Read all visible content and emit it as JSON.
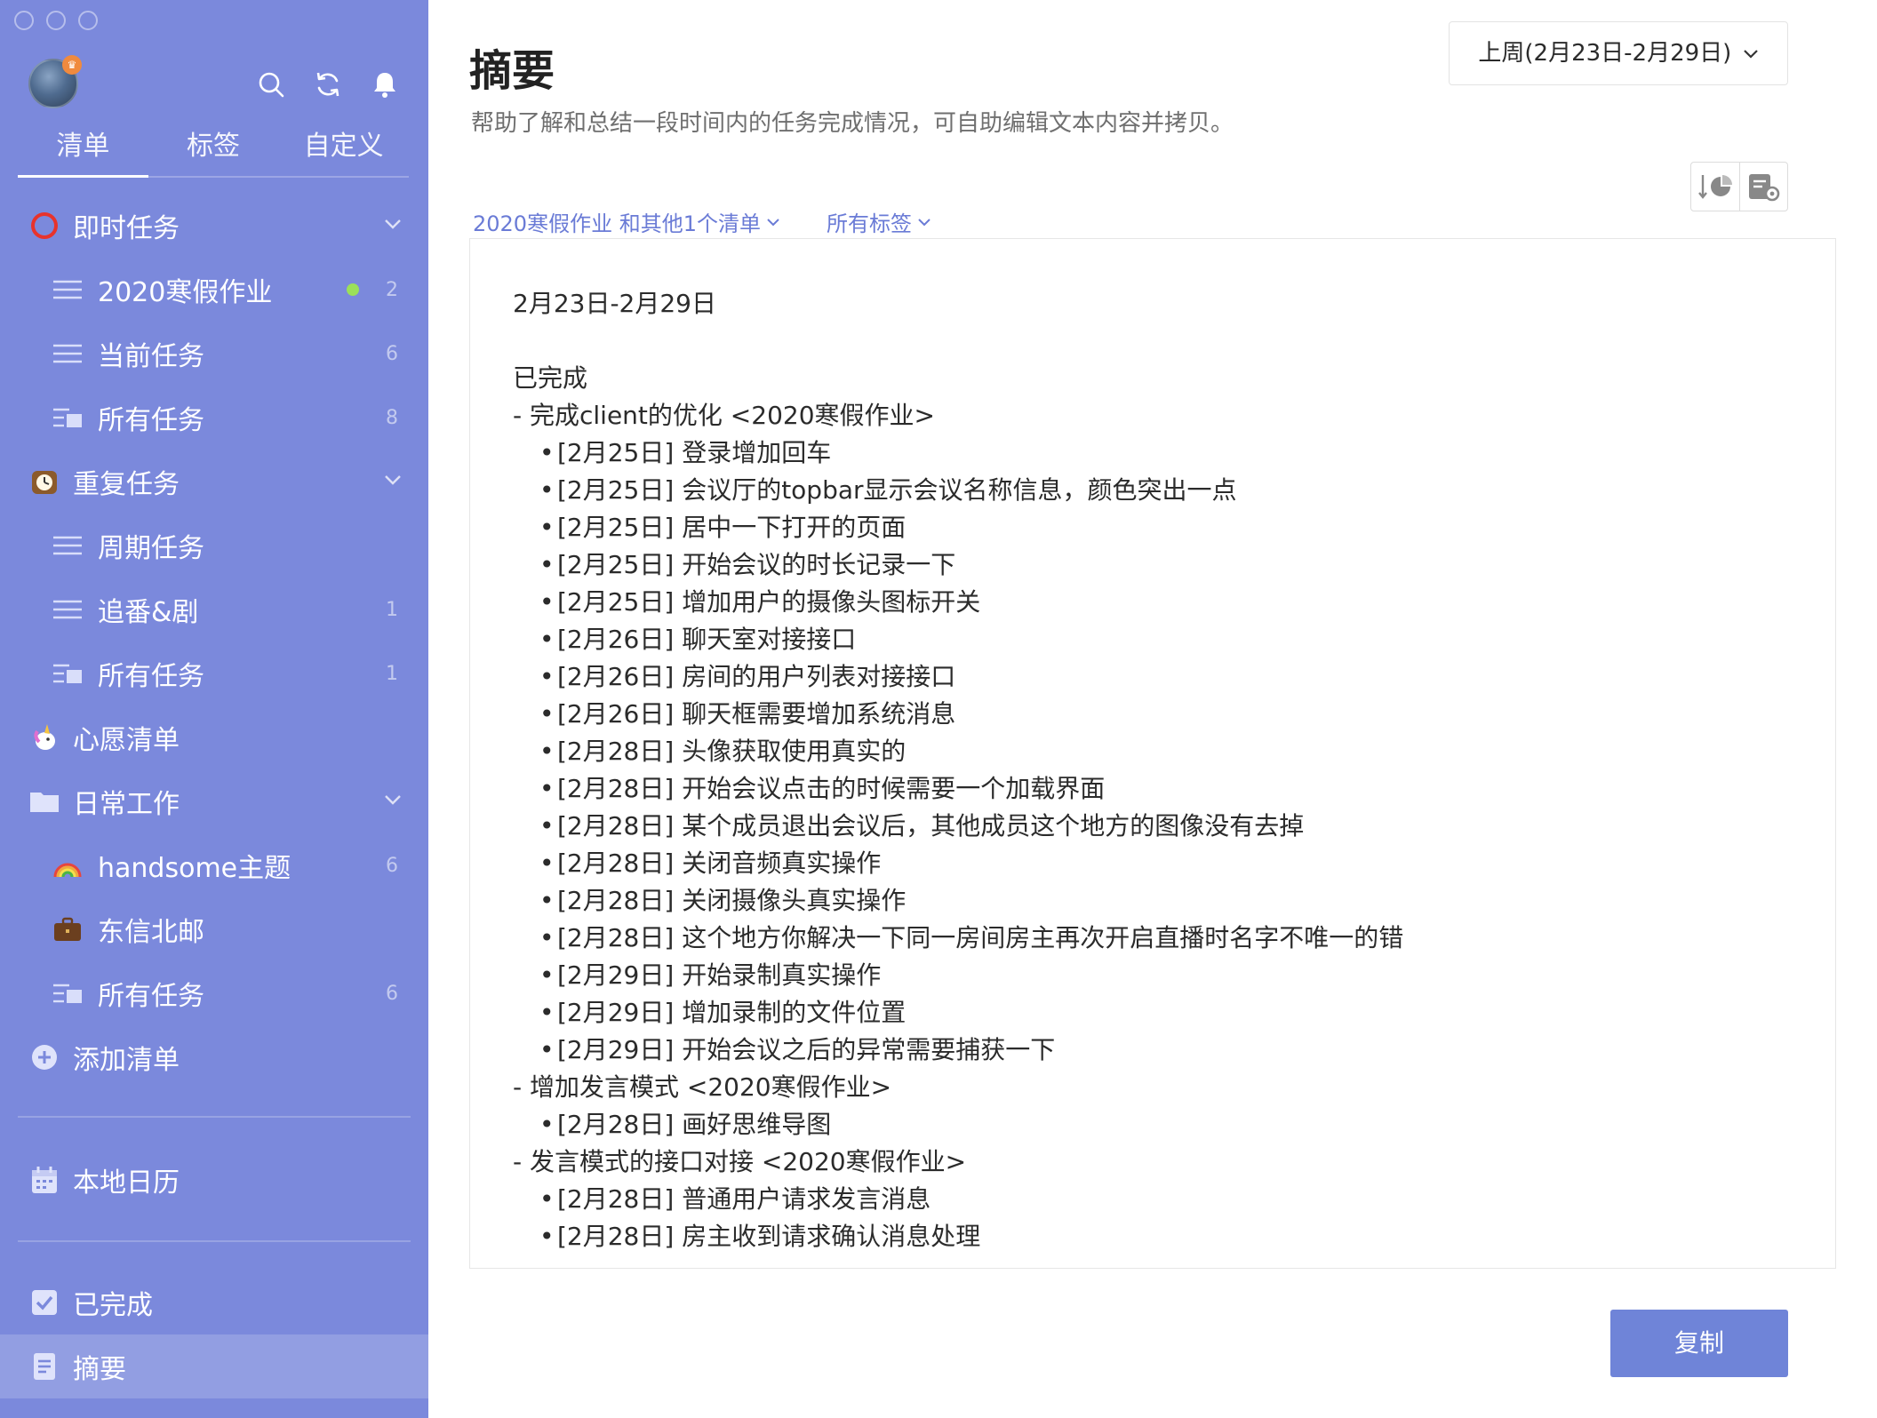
{
  "sidebar": {
    "tabs": [
      "清单",
      "标签",
      "自定义"
    ],
    "lists": {
      "instant": {
        "label": "即时任务",
        "icon": "red-ring-icon"
      },
      "homework": {
        "label": "2020寒假作业",
        "count": "2",
        "status_color": "#9be05a"
      },
      "current": {
        "label": "当前任务",
        "count": "6"
      },
      "all1": {
        "label": "所有任务",
        "count": "8"
      },
      "repeat": {
        "label": "重复任务",
        "icon": "clock-emoji-icon"
      },
      "periodic": {
        "label": "周期任务"
      },
      "anime": {
        "label": "追番&剧",
        "count": "1"
      },
      "all2": {
        "label": "所有任务",
        "count": "1"
      },
      "wish": {
        "label": "心愿清单",
        "icon": "unicorn-emoji-icon"
      },
      "daily": {
        "label": "日常工作",
        "icon": "folder-icon"
      },
      "handsome": {
        "label": "handsome主题",
        "count": "6",
        "icon": "rainbow-emoji-icon"
      },
      "dongxin": {
        "label": "东信北邮",
        "icon": "briefcase-emoji-icon"
      },
      "all3": {
        "label": "所有任务",
        "count": "6"
      },
      "add": {
        "label": "添加清单"
      }
    },
    "calendar": {
      "label": "本地日历"
    },
    "completed": {
      "label": "已完成"
    },
    "summary": {
      "label": "摘要"
    }
  },
  "main": {
    "title": "摘要",
    "subtitle": "帮助了解和总结一段时间内的任务完成情况，可自助编辑文本内容并拷贝。",
    "range": "上周(2月23日-2月29日)",
    "filter_lists": "2020寒假作业 和其他1个清单",
    "filter_tags": "所有标签",
    "copy_label": "复制",
    "summary": {
      "heading": "2月23日-2月29日",
      "section": "已完成",
      "groups": [
        {
          "title": "- 完成client的优化 <2020寒假作业>",
          "items": [
            "[2月25日] 登录增加回车",
            "[2月25日] 会议厅的topbar显示会议名称信息，颜色突出一点",
            "[2月25日] 居中一下打开的页面",
            "[2月25日] 开始会议的时长记录一下",
            "[2月25日] 增加用户的摄像头图标开关",
            "[2月26日] 聊天室对接接口",
            "[2月26日] 房间的用户列表对接接口",
            "[2月26日] 聊天框需要增加系统消息",
            "[2月28日] 头像获取使用真实的",
            "[2月28日] 开始会议点击的时候需要一个加载界面",
            "[2月28日] 某个成员退出会议后，其他成员这个地方的图像没有去掉",
            "[2月28日] 关闭音频真实操作",
            "[2月28日] 关闭摄像头真实操作",
            "[2月28日] 这个地方你解决一下同一房间房主再次开启直播时名字不唯一的错",
            "[2月29日] 开始录制真实操作",
            "[2月29日] 增加录制的文件位置",
            "[2月29日] 开始会议之后的异常需要捕获一下"
          ]
        },
        {
          "title": "- 增加发言模式 <2020寒假作业>",
          "items": [
            "[2月28日] 画好思维导图"
          ]
        },
        {
          "title": "- 发言模式的接口对接 <2020寒假作业>",
          "items": [
            "[2月28日] 普通用户请求发言消息",
            "[2月28日] 房主收到请求确认消息处理"
          ]
        }
      ]
    }
  }
}
